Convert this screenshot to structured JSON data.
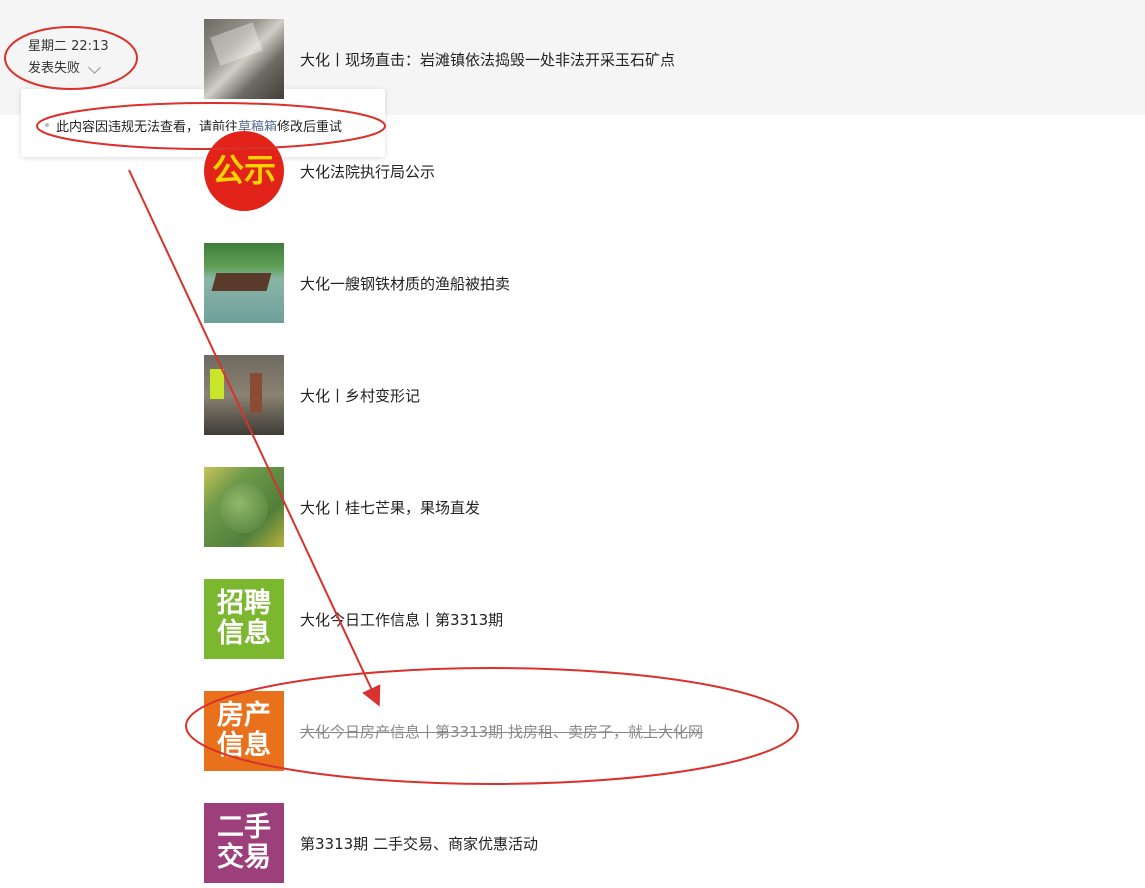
{
  "post": {
    "timestamp": "星期二 22:13",
    "status": "发表失败"
  },
  "tooltip": {
    "message_before": "此内容因违规无法查看，请前往",
    "link": "草稿箱",
    "message_after": "修改后重试"
  },
  "articles": [
    {
      "title": "大化丨现场直击：岩滩镇依法捣毁一处非法开采玉石矿点",
      "thumb": "rocks-photo"
    },
    {
      "title": "大化法院执行局公示",
      "thumb": "gongshi-badge",
      "thumb_text": "公示"
    },
    {
      "title": "大化一艘钢铁材质的渔船被拍卖",
      "thumb": "boat-photo"
    },
    {
      "title": "大化丨乡村变形记",
      "thumb": "village-photo"
    },
    {
      "title": "大化丨桂七芒果，果场直发",
      "thumb": "mango-photo"
    },
    {
      "title": "大化今日工作信息丨第3313期",
      "thumb": "recruit-tile",
      "thumb_line1": "招聘",
      "thumb_line2": "信息"
    },
    {
      "title": "大化今日房产信息丨第3313期 找房租、卖房子，就上大化网",
      "thumb": "property-tile",
      "thumb_line1": "房产",
      "thumb_line2": "信息",
      "struck": true
    },
    {
      "title": "第3313期 二手交易、商家优惠活动",
      "thumb": "secondhand-tile",
      "thumb_line1": "二手",
      "thumb_line2": "交易"
    }
  ],
  "colors": {
    "annotation": "#d9312b",
    "link": "#576b95",
    "recruit": "#7cb82f",
    "property": "#e9711c",
    "secondhand": "#9c3f7a"
  }
}
